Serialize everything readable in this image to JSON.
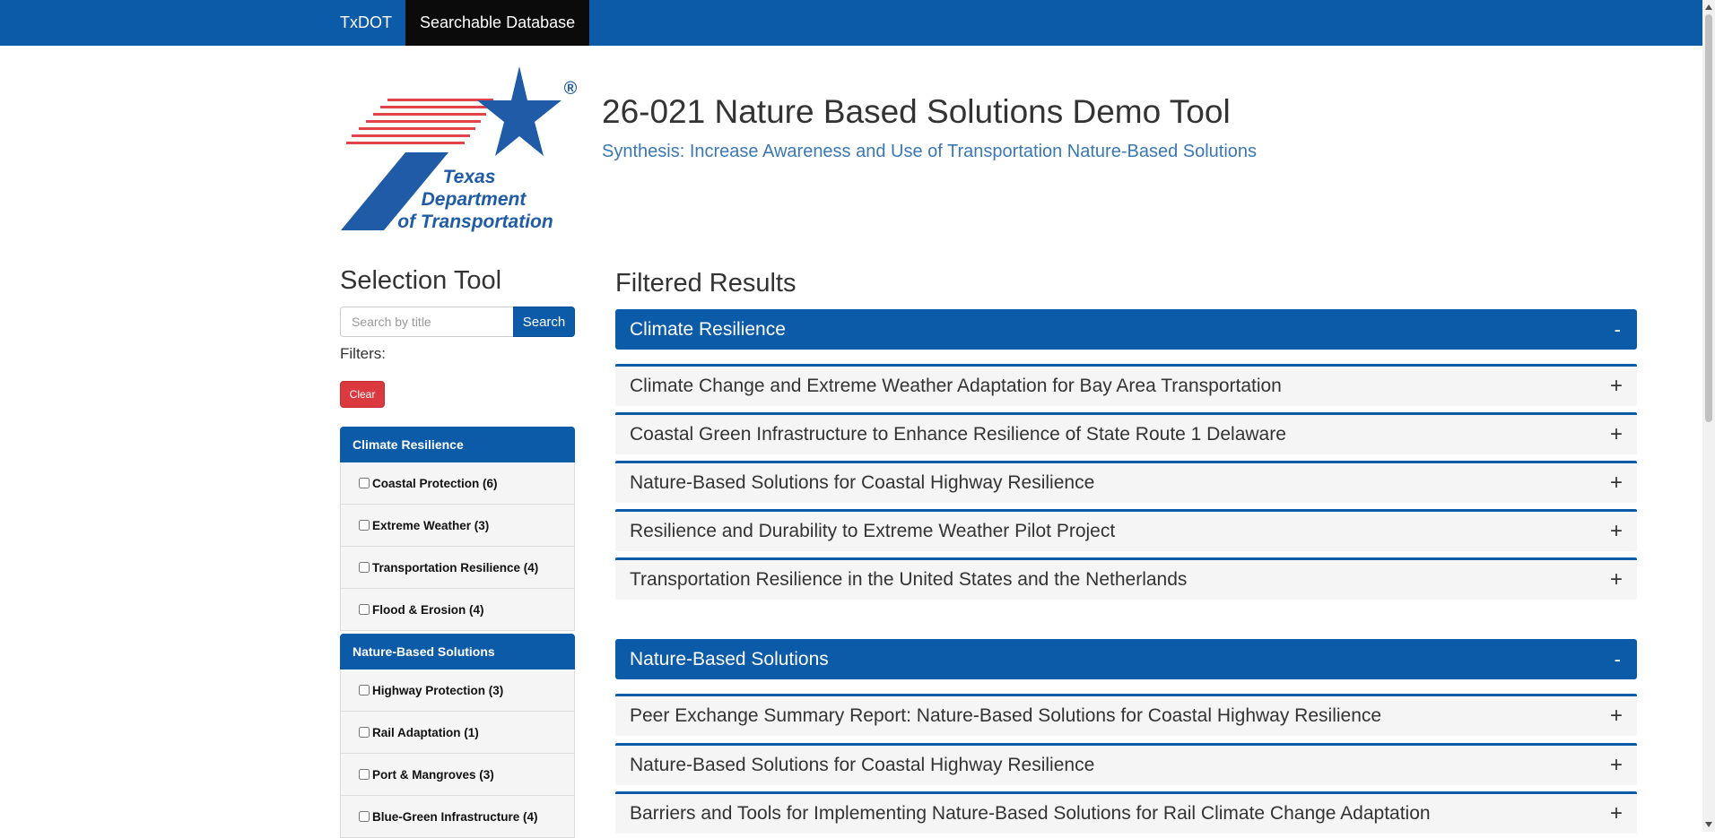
{
  "nav": {
    "brand": "TxDOT",
    "active": "Searchable Database"
  },
  "header": {
    "logo_lines": [
      "Texas",
      "Department",
      "of Transportation"
    ],
    "logo_mark": "®",
    "title": "26-021 Nature Based Solutions Demo Tool",
    "subtitle": "Synthesis: Increase Awareness and Use of Transportation Nature-Based Solutions"
  },
  "sidebar": {
    "heading": "Selection Tool",
    "search_placeholder": "Search by title",
    "search_button": "Search",
    "filters_label": "Filters:",
    "clear_button": "Clear",
    "panels": [
      {
        "title": "Climate Resilience",
        "items": [
          "Coastal Protection (6)",
          "Extreme Weather (3)",
          "Transportation Resilience (4)",
          "Flood & Erosion (4)"
        ]
      },
      {
        "title": "Nature-Based Solutions",
        "items": [
          "Highway Protection (3)",
          "Rail Adaptation (1)",
          "Port & Mangroves (3)",
          "Blue-Green Infrastructure (4)"
        ]
      }
    ]
  },
  "results": {
    "heading": "Filtered Results",
    "categories": [
      {
        "title": "Climate Resilience",
        "toggle": "-",
        "items": [
          "Climate Change and Extreme Weather Adaptation for Bay Area Transportation",
          "Coastal Green Infrastructure to Enhance Resilience of State Route 1 Delaware",
          "Nature-Based Solutions for Coastal Highway Resilience",
          "Resilience and Durability to Extreme Weather Pilot Project",
          "Transportation Resilience in the United States and the Netherlands"
        ]
      },
      {
        "title": "Nature-Based Solutions",
        "toggle": "-",
        "items": [
          "Peer Exchange Summary Report: Nature-Based Solutions for Coastal Highway Resilience",
          "Nature-Based Solutions for Coastal Highway Resilience",
          "Barriers and Tools for Implementing Nature-Based Solutions for Rail Climate Change Adaptation"
        ]
      }
    ],
    "expand_symbol": "+"
  },
  "colors": {
    "brand_blue": "#0c5ba9",
    "nav_active": "#0b0b0b",
    "subtitle": "#3a78b5",
    "clear_red": "#d9393f",
    "logo_red": "#e2434b",
    "logo_blue": "#1f5ba6"
  }
}
